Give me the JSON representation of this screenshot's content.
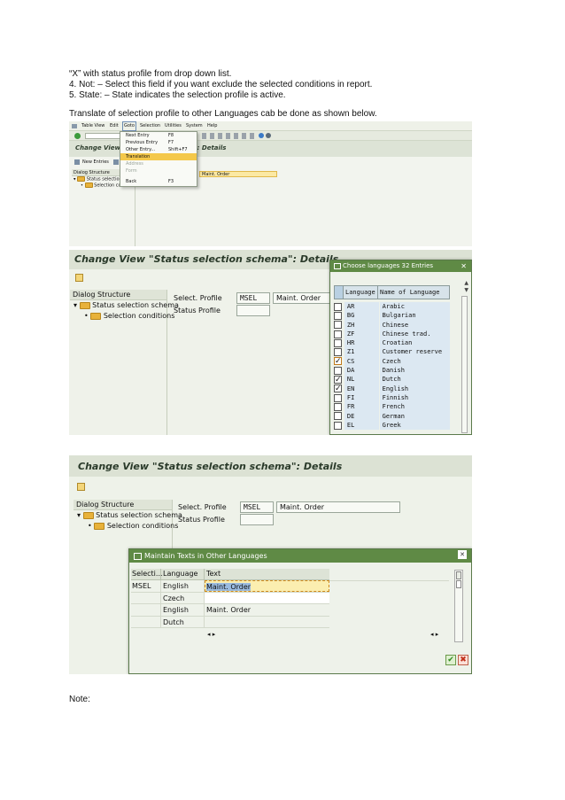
{
  "document": {
    "lines": [
      "“X” with status profile from drop down list.",
      "4. Not: – Select this field if you want exclude the selected conditions in report.",
      "5. State: – State indicates the selection profile is active."
    ],
    "translate_note": "Translate of selection profile to other Languages cab be done as shown below.",
    "footer_note": "Note:"
  },
  "shot1": {
    "menu_bar": [
      "Table View",
      "Edit",
      "Goto",
      "Selection",
      "Utilities",
      "System",
      "Help"
    ],
    "title": "Change View \"",
    "title_suffix": "\": Details",
    "new_entries": "New Entries",
    "dialog_structure": "Dialog Structure",
    "tree": [
      "Status selection s",
      "Selection con"
    ],
    "field_value": "Maint. Order",
    "goto_menu": [
      {
        "label": "Next Entry",
        "shortcut": "F8"
      },
      {
        "label": "Previous Entry",
        "shortcut": "F7"
      },
      {
        "label": "Other Entry...",
        "shortcut": "Shift+F7"
      },
      {
        "label": "Translation",
        "shortcut": ""
      },
      {
        "label": "Address",
        "shortcut": ""
      },
      {
        "label": "Form",
        "shortcut": ""
      },
      {
        "label": "Back",
        "shortcut": "F3"
      }
    ]
  },
  "shot2": {
    "title": "Change View \"Status selection schema\": Details",
    "dialog_structure": "Dialog Structure",
    "tree": [
      "Status selection schema",
      "Selection conditions"
    ],
    "select_profile_label": "Select. Profile",
    "select_profile_value": "MSEL",
    "select_profile_text": "Maint. Order",
    "status_profile_label": "Status Profile",
    "popup_title": "Choose languages 32 Entries",
    "col_language": "Language",
    "col_name": "Name of Language",
    "languages": [
      {
        "code": "AR",
        "name": "Arabic",
        "checked": false
      },
      {
        "code": "BG",
        "name": "Bulgarian",
        "checked": false
      },
      {
        "code": "ZH",
        "name": "Chinese",
        "checked": false
      },
      {
        "code": "ZF",
        "name": "Chinese trad.",
        "checked": false
      },
      {
        "code": "HR",
        "name": "Croatian",
        "checked": false
      },
      {
        "code": "Z1",
        "name": "Customer reserve",
        "checked": false
      },
      {
        "code": "CS",
        "name": "Czech",
        "checked": true
      },
      {
        "code": "DA",
        "name": "Danish",
        "checked": false
      },
      {
        "code": "NL",
        "name": "Dutch",
        "checked": true
      },
      {
        "code": "EN",
        "name": "English",
        "checked": true
      },
      {
        "code": "FI",
        "name": "Finnish",
        "checked": false
      },
      {
        "code": "FR",
        "name": "French",
        "checked": false
      },
      {
        "code": "DE",
        "name": "German",
        "checked": false
      },
      {
        "code": "EL",
        "name": "Greek",
        "checked": false
      }
    ],
    "check_mark": "✓"
  },
  "shot3": {
    "title": "Change View \"Status selection schema\": Details",
    "dialog_structure": "Dialog Structure",
    "tree": [
      "Status selection schema",
      "Selection conditions"
    ],
    "select_profile_label": "Select. Profile",
    "select_profile_value": "MSEL",
    "select_profile_text": "Maint. Order",
    "status_profile_label": "Status Profile",
    "popup_title": "Maintain Texts in Other Languages",
    "columns": [
      "Selecti...",
      "Language",
      "Text"
    ],
    "rows": [
      {
        "sel": "MSEL",
        "lang": "English",
        "text": "Maint. Order"
      },
      {
        "sel": "",
        "lang": "Czech",
        "text": ""
      },
      {
        "sel": "",
        "lang": "English",
        "text": "Maint. Order"
      },
      {
        "sel": "",
        "lang": "Dutch",
        "text": ""
      }
    ],
    "scroll_arrows": "◂ ▸",
    "ok_glyph": "✔",
    "cancel_glyph": "✖",
    "close_glyph": "✕"
  }
}
